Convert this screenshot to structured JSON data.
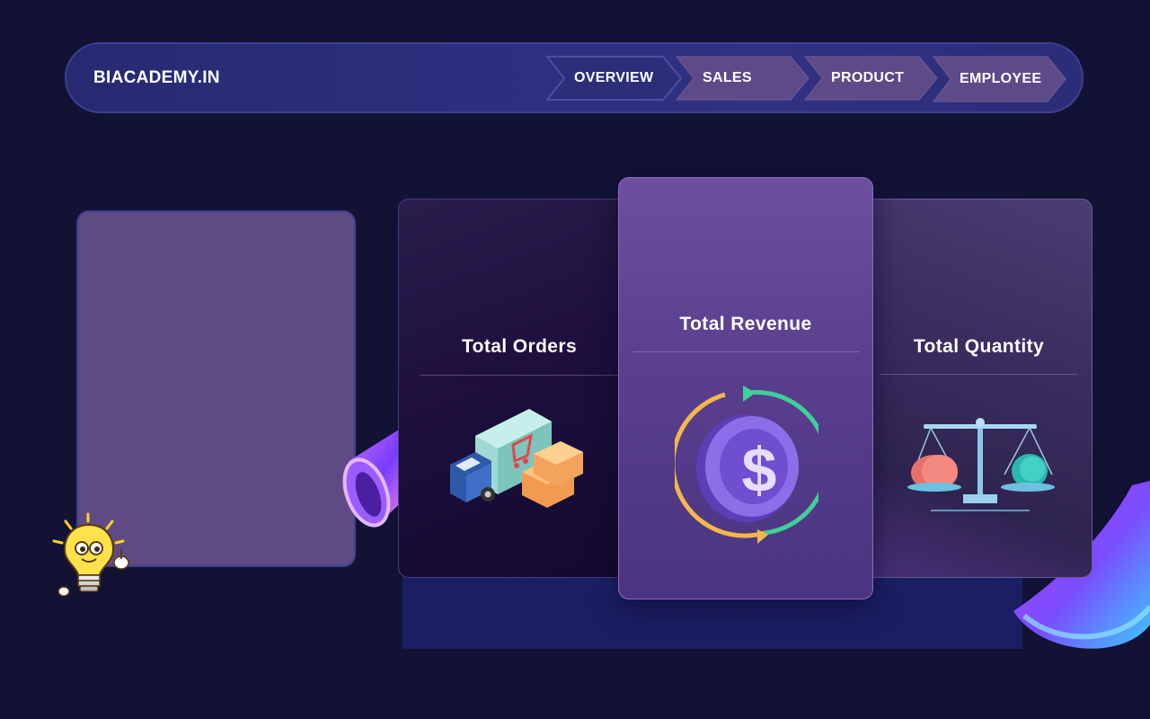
{
  "header": {
    "brand": "BIACADEMY.IN",
    "nav": [
      {
        "label": "OVERVIEW",
        "active": true
      },
      {
        "label": "SALES",
        "active": false
      },
      {
        "label": "PRODUCT",
        "active": false
      },
      {
        "label": "EMPLOYEE",
        "active": false
      }
    ]
  },
  "cards": {
    "orders": {
      "title": "Total Orders",
      "icon": "delivery-truck-icon"
    },
    "revenue": {
      "title": "Total Revenue",
      "icon": "dollar-coin-icon"
    },
    "quantity": {
      "title": "Total Quantity",
      "icon": "balance-scale-icon"
    }
  },
  "colors": {
    "background": "#121235",
    "nav_active": "#2c2e7a",
    "nav_inactive": "#5e4a86",
    "panel": "#5f4a85",
    "revenue_card": "#6d4fa1"
  }
}
